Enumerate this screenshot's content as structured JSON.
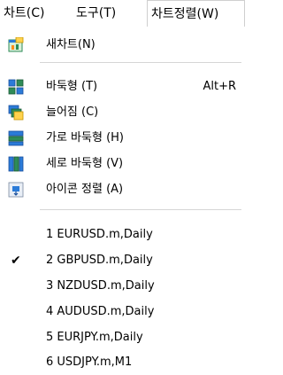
{
  "menubar": {
    "items": [
      {
        "label": "차트(C)"
      },
      {
        "label": "도구(T)"
      },
      {
        "label": "차트정렬(W)"
      }
    ]
  },
  "menu": {
    "new_chart": {
      "label": "새차트(N)",
      "icon": "new-chart-icon"
    },
    "arrange": [
      {
        "label": "바둑형 (T)",
        "shortcut": "Alt+R",
        "icon": "tile-icon"
      },
      {
        "label": "늘어짐 (C)",
        "shortcut": "",
        "icon": "cascade-icon"
      },
      {
        "label": "가로 바둑형 (H)",
        "shortcut": "",
        "icon": "tile-horizontal-icon"
      },
      {
        "label": "세로 바둑형 (V)",
        "shortcut": "",
        "icon": "tile-vertical-icon"
      },
      {
        "label": "아이콘 정렬 (A)",
        "shortcut": "",
        "icon": "arrange-icons-icon"
      }
    ],
    "windows": [
      {
        "label": "1 EURUSD.m,Daily",
        "checked": false
      },
      {
        "label": "2 GBPUSD.m,Daily",
        "checked": true
      },
      {
        "label": "3 NZDUSD.m,Daily",
        "checked": false
      },
      {
        "label": "4 AUDUSD.m,Daily",
        "checked": false
      },
      {
        "label": "5 EURJPY.m,Daily",
        "checked": false
      },
      {
        "label": "6 USDJPY.m,M1",
        "checked": false
      }
    ],
    "check_mark": "✔"
  }
}
